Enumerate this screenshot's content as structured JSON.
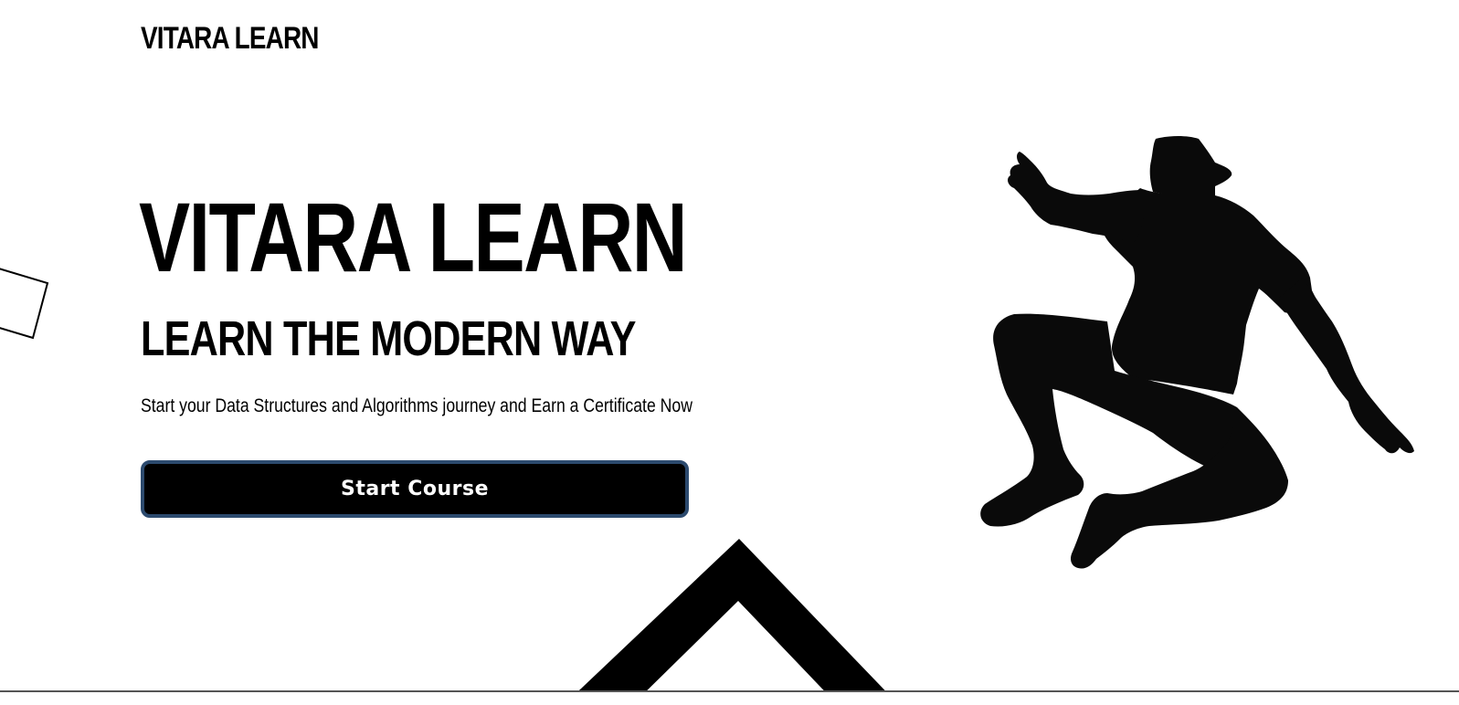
{
  "header": {
    "brand": "VITARA LEARN"
  },
  "hero": {
    "title": "VITARA LEARN",
    "subtitle": "LEARN THE MODERN WAY",
    "description": "Start your Data Structures and Algorithms journey and Earn a Certificate Now",
    "cta_label": "Start Course"
  },
  "illustrations": {
    "figure": "jumping-person-silhouette-icon",
    "shapes": [
      "square-outline-icon",
      "chevron-up-icon"
    ]
  },
  "colors": {
    "background": "#ffffff",
    "text": "#000000",
    "button_bg": "#000000",
    "button_border": "#2c4a6e",
    "button_text": "#ffffff"
  }
}
